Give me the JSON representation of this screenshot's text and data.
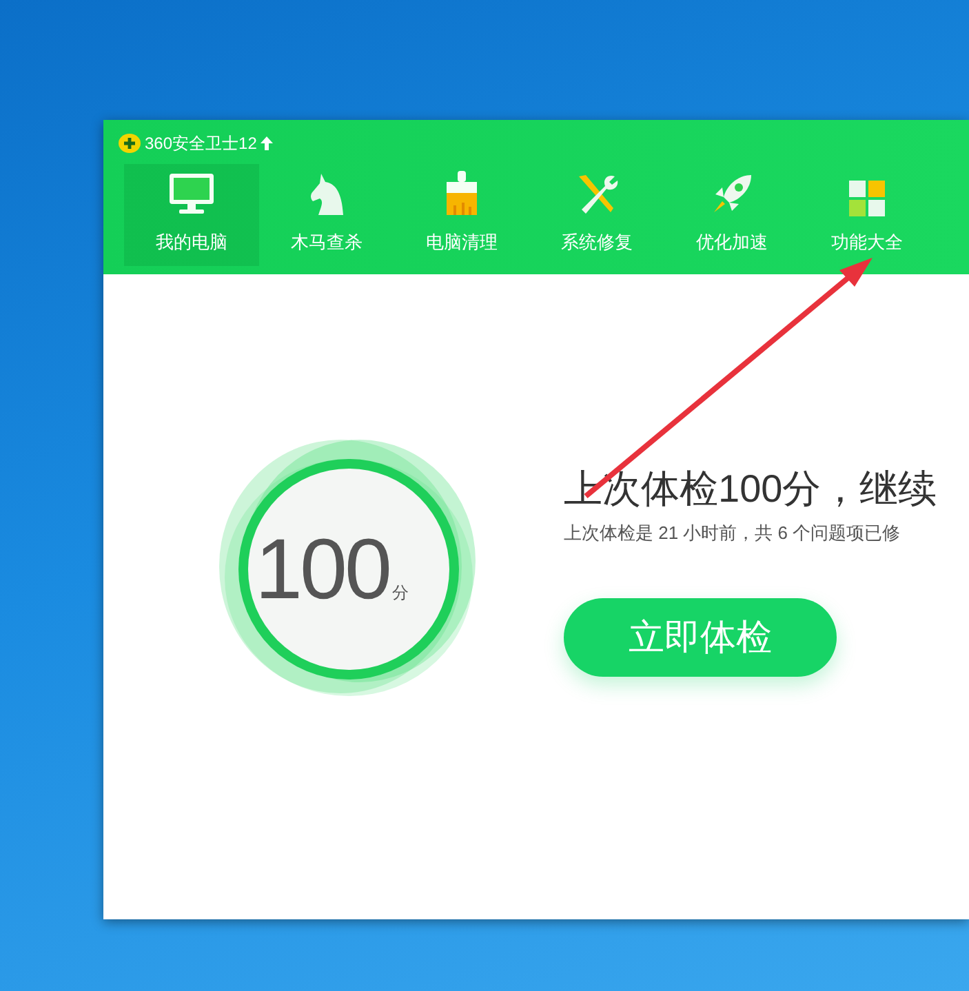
{
  "window": {
    "title": "360安全卫士12"
  },
  "tabs": [
    {
      "label": "我的电脑",
      "selected": true
    },
    {
      "label": "木马查杀",
      "selected": false
    },
    {
      "label": "电脑清理",
      "selected": false
    },
    {
      "label": "系统修复",
      "selected": false
    },
    {
      "label": "优化加速",
      "selected": false
    },
    {
      "label": "功能大全",
      "selected": false
    }
  ],
  "score": {
    "value": "100",
    "unit": "分"
  },
  "headline": "上次体检100分，继续",
  "subline": "上次体检是 21 小时前，共 6 个问题项已修",
  "check_button": "立即体检"
}
